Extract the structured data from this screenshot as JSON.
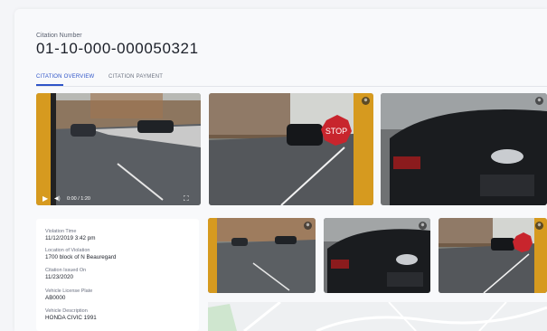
{
  "citation": {
    "label": "Citation Number",
    "number": "01-10-000-000050321"
  },
  "tabs": [
    {
      "label": "CITATION OVERVIEW",
      "active": true
    },
    {
      "label": "CITATION PAYMENT",
      "active": false
    }
  ],
  "video": {
    "time": "0:00 / 1:20",
    "play_icon": "play-icon",
    "volume_icon": "volume-icon",
    "fullscreen_icon": "fullscreen-icon",
    "progress": 0.0
  },
  "details": [
    {
      "label": "Violation Time",
      "value": "11/12/2019 3:42 pm"
    },
    {
      "label": "Location of Violation",
      "value": "1700 block of N Beauregard"
    },
    {
      "label": "Citation Issued On",
      "value": "11/23/2020"
    },
    {
      "label": "Vehicle License Plate",
      "value": "AB0000"
    },
    {
      "label": "Vehicle Description",
      "value": "HONDA CIVIC 1991"
    }
  ],
  "colors": {
    "accent": "#2f55c8",
    "stop_sign": "#c8252d"
  }
}
